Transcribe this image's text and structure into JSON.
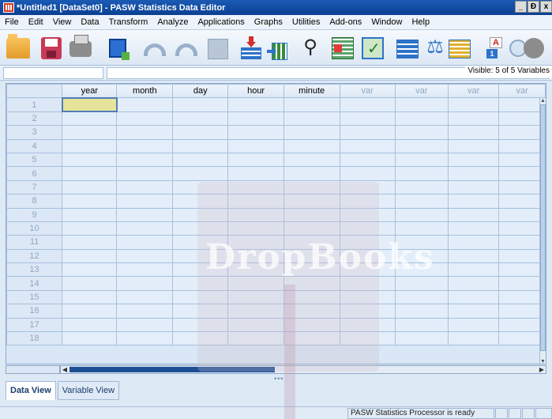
{
  "window": {
    "title": "*Untitled1 [DataSet0] - PASW Statistics Data Editor",
    "buttons": [
      "_",
      "Ɖ",
      "x"
    ]
  },
  "menubar": [
    "File",
    "Edit",
    "View",
    "Data",
    "Transform",
    "Analyze",
    "Applications",
    "Graphs",
    "Utilities",
    "Add-ons",
    "Window",
    "Help"
  ],
  "toolbar": {
    "icons": [
      "open-folder-icon",
      "save-icon",
      "print-icon",
      "dialog-recall-icon",
      "undo-icon",
      "redo-icon",
      "go-to-data-icon",
      "go-to-case-icon",
      "go-to-variable-icon",
      "find-binoculars-icon",
      "split-file-icon",
      "select-cases-icon",
      "weight-cases-icon",
      "scale-icon",
      "value-labels-icon",
      "insert-label-icon",
      "use-variable-sets-icon"
    ]
  },
  "editline": {
    "visible_text": "Visible: 5 of 5 Variables"
  },
  "grid": {
    "columns": [
      "year",
      "month",
      "day",
      "hour",
      "minute",
      "var",
      "var",
      "var",
      "var"
    ],
    "named_columns": 5,
    "rows": [
      "1",
      "2",
      "3",
      "4",
      "5",
      "6",
      "7",
      "8",
      "9",
      "10",
      "11",
      "12",
      "13",
      "14",
      "15",
      "16",
      "17",
      "18"
    ],
    "active_cell": {
      "row": 1,
      "column": "year"
    }
  },
  "tabs": {
    "data_view": "Data View",
    "variable_view": "Variable View",
    "active": "Data View"
  },
  "statusbar": {
    "processor": "PASW Statistics Processor is ready"
  },
  "watermark": "DropBooks",
  "colors": {
    "title_bar": "#0b3f92",
    "grid_background": "#e3eefa",
    "active_cell": "#e8e39a",
    "scroll_thumb": "#1d4f96"
  }
}
